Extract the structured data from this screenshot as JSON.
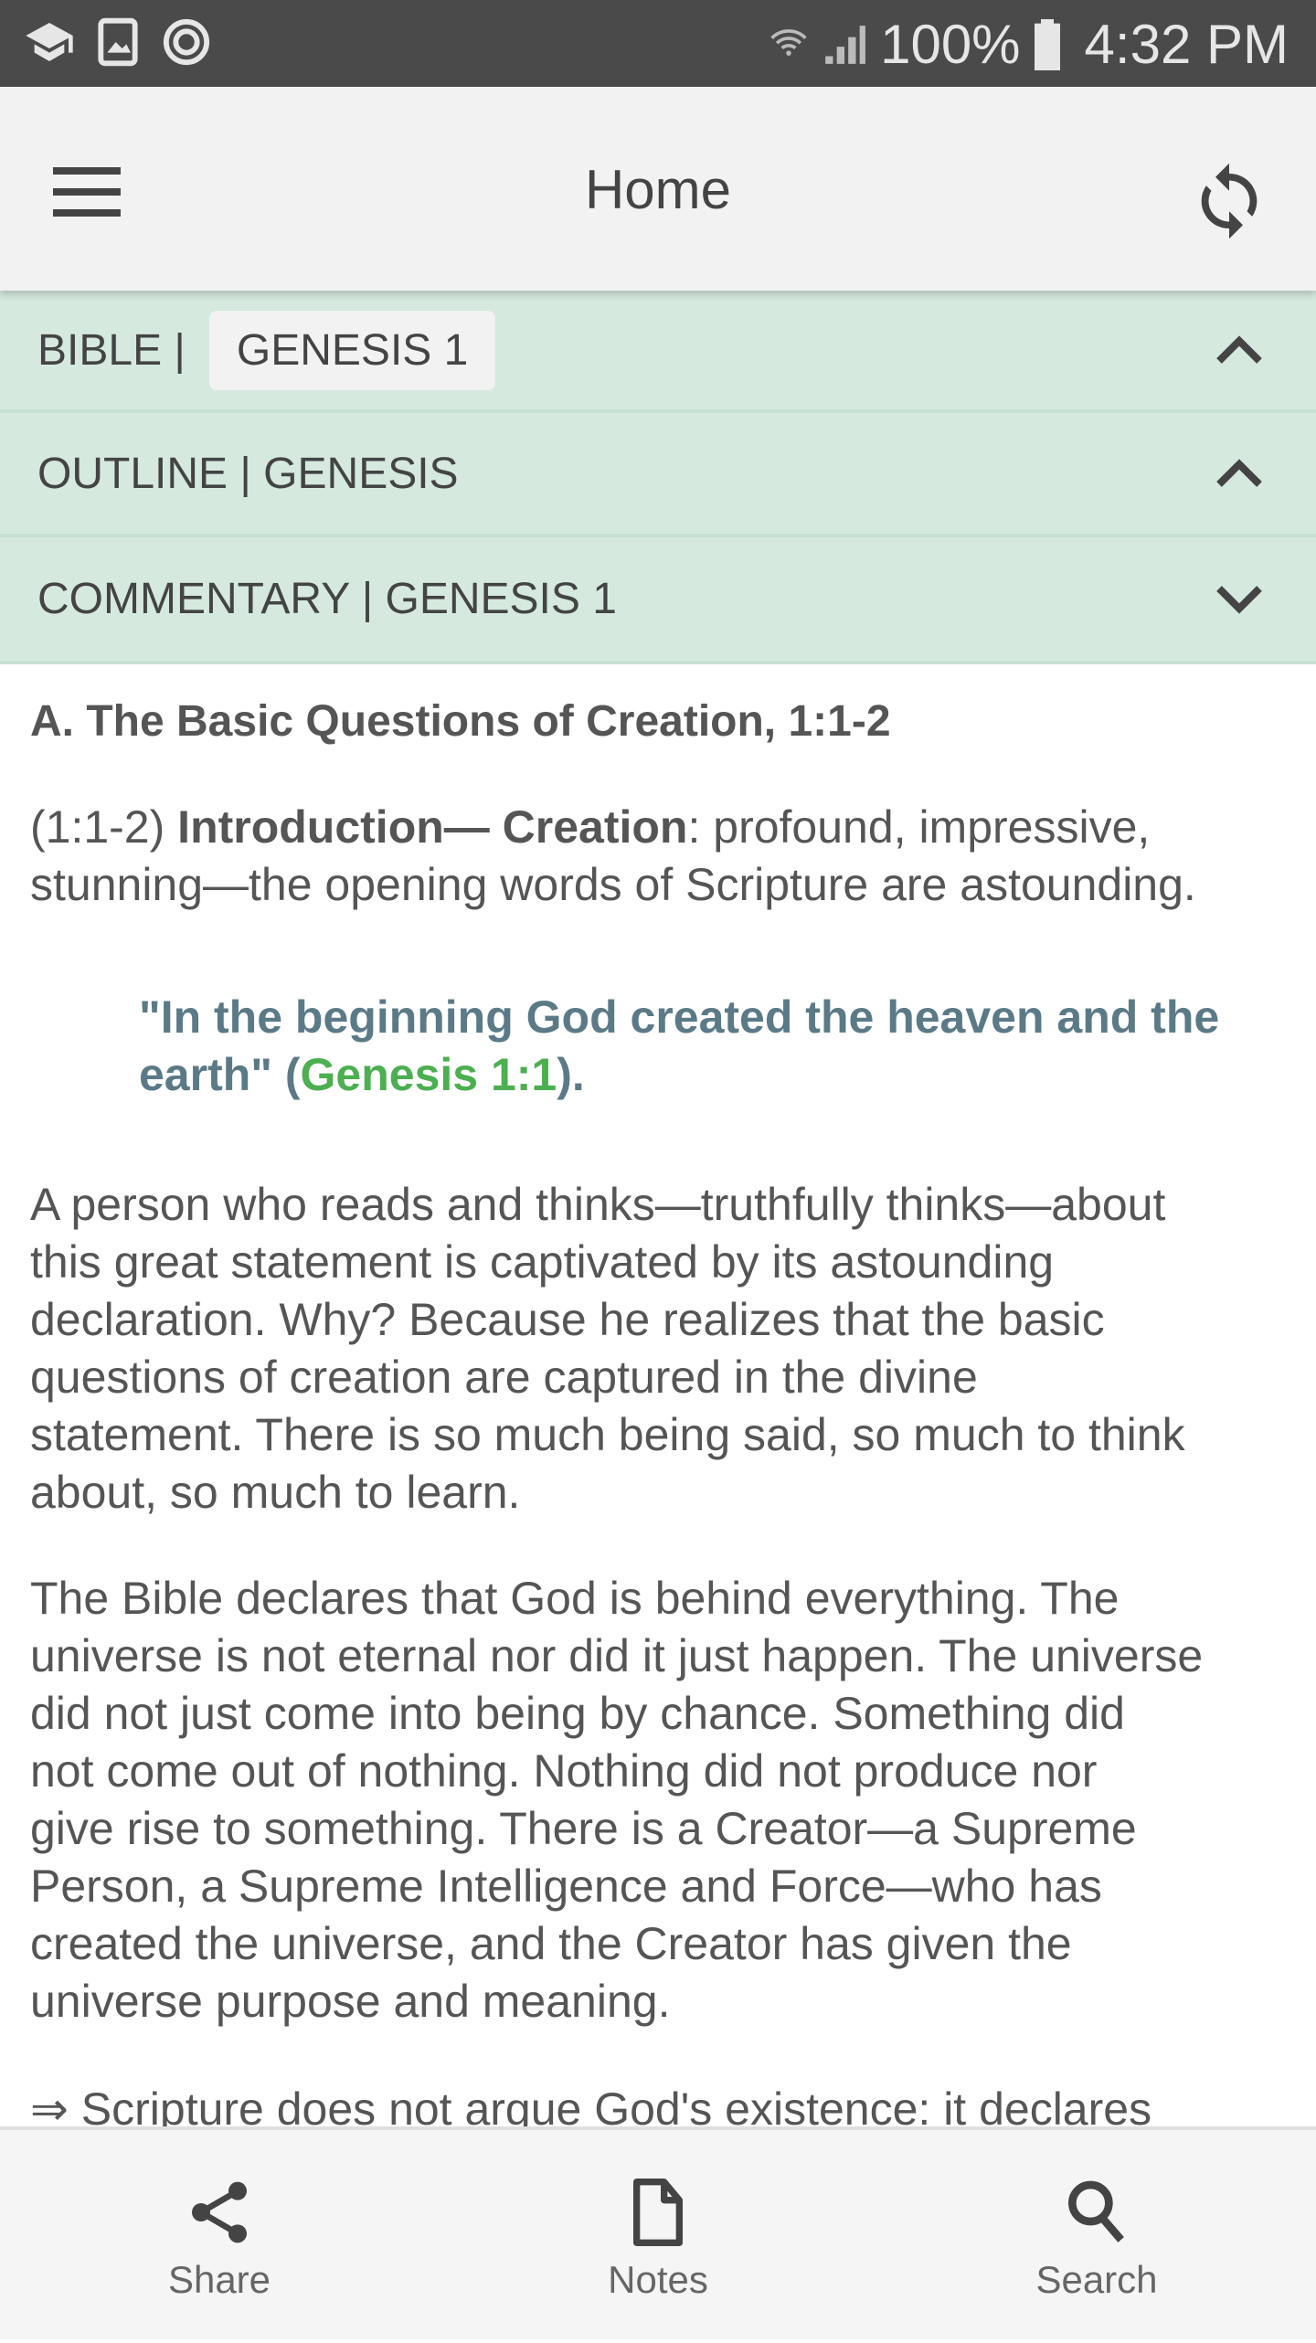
{
  "status_bar": {
    "battery": "100%",
    "time": "4:32 PM",
    "icons": [
      "education-icon",
      "gallery-icon",
      "sync-status-icon",
      "wifi-icon",
      "signal-icon",
      "battery-icon"
    ]
  },
  "app_bar": {
    "title": "Home",
    "menu_icon": "hamburger-icon",
    "refresh_icon": "refresh-icon"
  },
  "sections": [
    {
      "label": "BIBLE |",
      "chip": "GENESIS 1",
      "state": "expanded"
    },
    {
      "label": "OUTLINE | GENESIS",
      "state": "expanded"
    },
    {
      "label": "COMMENTARY | GENESIS 1",
      "state": "collapsed"
    }
  ],
  "content": {
    "heading": "A. The Basic Questions of Creation, 1:1-2",
    "intro": {
      "ref": "(1:1-2) ",
      "bold": "Introduction— Creation",
      "rest": ": profound, impressive,",
      "line2": "stunning—the opening words of Scripture are astounding."
    },
    "quote": {
      "line1": "\"In the beginning God created the heaven and the",
      "line2_pre": "earth\" (",
      "ref": "Genesis 1:1",
      "line2_post": ")."
    },
    "para2": [
      "A person who reads and thinks—truthfully thinks—about",
      "this great statement is captivated by its astounding",
      "declaration. Why? Because he realizes that the basic",
      "questions of creation are captured in the divine",
      "statement. There is so much being said, so much to think",
      "about, so much to learn."
    ],
    "para3": [
      "The Bible declares that God is behind everything. The",
      "universe is not eternal nor did it just happen. The universe",
      "did not just come into being by chance. Something did",
      "not come out of nothing. Nothing did not produce nor",
      "give rise to something. There is a Creator—a Supreme",
      "Person, a Supreme Intelligence and Force—who has",
      "created the universe, and the Creator has given the",
      "universe purpose and meaning."
    ],
    "bullet": "⇒ Scripture does not argue God's existence: it declares"
  },
  "bottom_nav": [
    {
      "label": "Share",
      "icon": "share-icon"
    },
    {
      "label": "Notes",
      "icon": "note-icon"
    },
    {
      "label": "Search",
      "icon": "search-icon"
    }
  ],
  "colors": {
    "section_bg": "#d5e9df",
    "quote": "#5b7a87",
    "reference": "#4caf50",
    "status_bar": "#4a4a4a"
  }
}
